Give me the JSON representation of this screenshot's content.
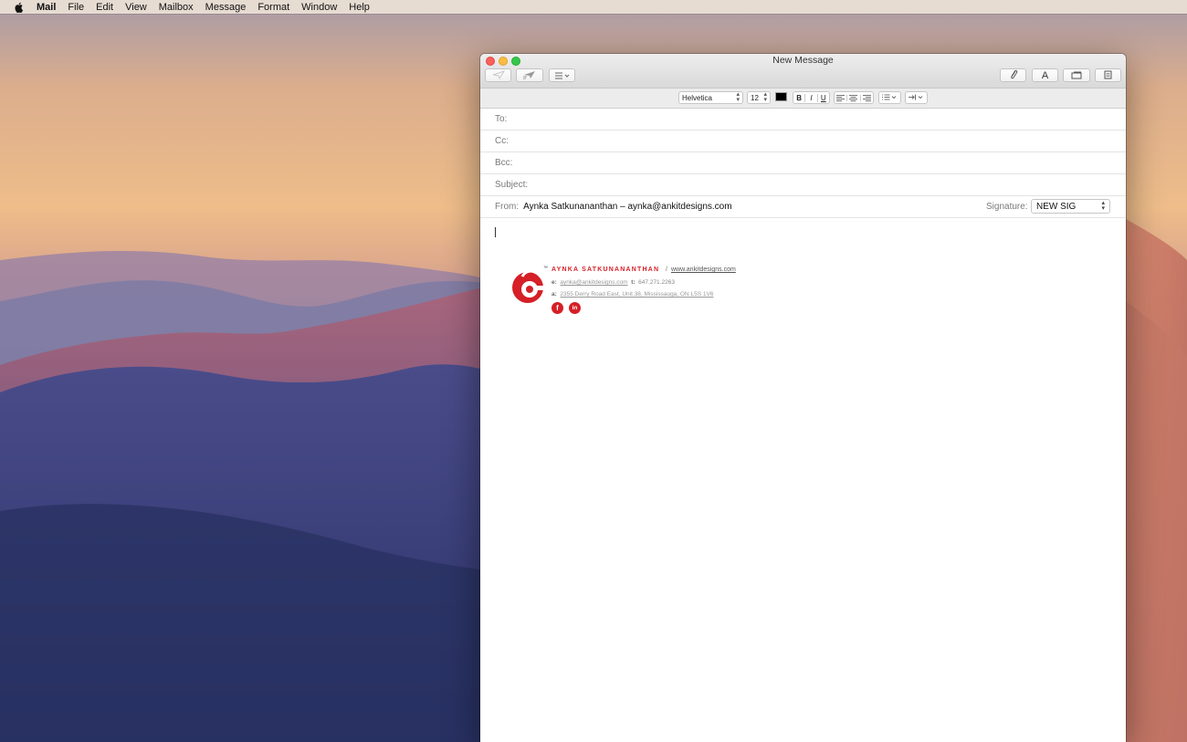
{
  "menubar": {
    "app": "Mail",
    "items": [
      "File",
      "Edit",
      "View",
      "Mailbox",
      "Message",
      "Format",
      "Window",
      "Help"
    ]
  },
  "window": {
    "title": "New Message",
    "toolbar_icons": [
      "send-icon",
      "reply-icon",
      "header-fields-menu-icon",
      "attachment-icon",
      "fonts-icon",
      "photo-browser-icon",
      "stationery-icon"
    ]
  },
  "format_bar": {
    "font": "Helvetica",
    "size": "12",
    "text_color": "#000000",
    "bold": "B",
    "italic": "I",
    "underline": "U",
    "align_icons": [
      "align-left-icon",
      "align-center-icon",
      "align-right-icon"
    ],
    "list_icon": "list-icon",
    "indent_icon": "indent-icon"
  },
  "headers": {
    "to_label": "To:",
    "cc_label": "Cc:",
    "bcc_label": "Bcc:",
    "subject_label": "Subject:",
    "from_label": "From:",
    "from_value": "Aynka Satkunananthan – aynka@ankitdesigns.com",
    "signature_label": "Signature:",
    "signature_value": "NEW SIG"
  },
  "signature": {
    "name": "AYNKA SATKUNANANTHAN",
    "separator": "/",
    "website": "www.ankitdesigns.com",
    "email_label": "e:",
    "email": "aynka@ankitdesigns.com",
    "phone_label": "t:",
    "phone": "647.271.2263",
    "address_label": "a:",
    "address": "2355 Derry Road East, Unit 38, Mississauga, ON L5S 1V6",
    "trademark": "™",
    "facebook": "f",
    "linkedin": "in",
    "brand_color": "#d61f26"
  }
}
